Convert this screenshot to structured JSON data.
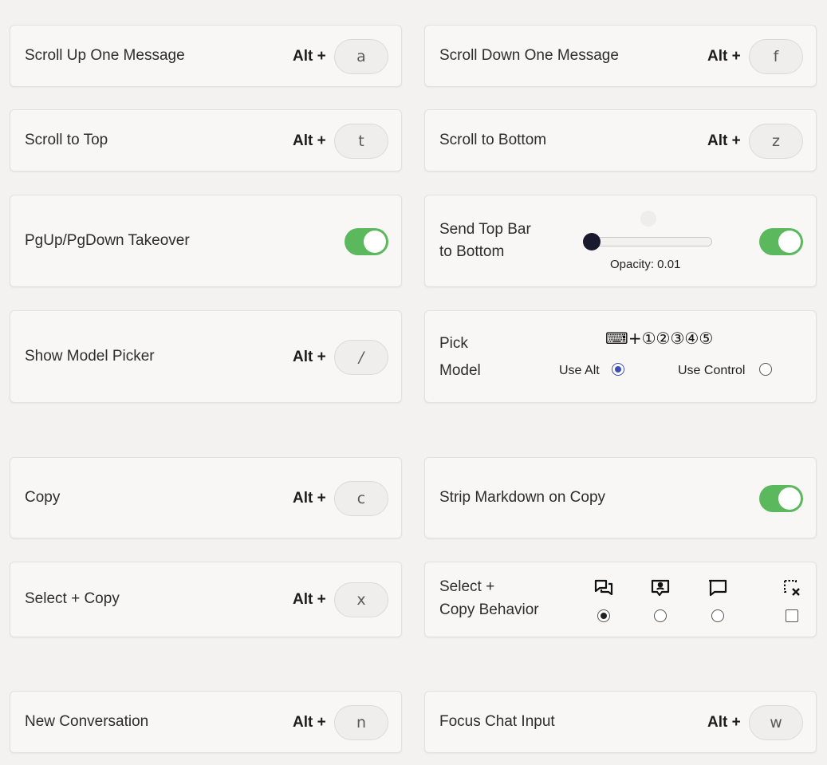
{
  "modifier_alt": "Alt +",
  "rows": {
    "scroll_up": {
      "label": "Scroll Up One Message",
      "key": "a"
    },
    "scroll_down": {
      "label": "Scroll Down One Message",
      "key": "f"
    },
    "scroll_top": {
      "label": "Scroll to Top",
      "key": "t"
    },
    "scroll_bottom": {
      "label": "Scroll to Bottom",
      "key": "z"
    },
    "pg_takeover": {
      "label": "PgUp/PgDown Takeover",
      "enabled": true
    },
    "send_top_bar": {
      "label_line1": "Send Top Bar",
      "label_line2": "to Bottom",
      "opacity_label": "Opacity: 0.01",
      "opacity_value": 0.01,
      "enabled": true
    },
    "model_picker": {
      "label": "Show Model Picker",
      "key": "/"
    },
    "pick_model": {
      "label_line1": "Pick",
      "label_line2": "Model",
      "hint": "⌨+①②③④⑤",
      "use_alt": "Use Alt",
      "use_control": "Use Control",
      "selected": "alt"
    },
    "copy": {
      "label": "Copy",
      "key": "c"
    },
    "strip_markdown": {
      "label": "Strip Markdown on Copy",
      "enabled": true
    },
    "select_copy": {
      "label": "Select + Copy",
      "key": "x"
    },
    "copy_behavior": {
      "label_line1": "Select +",
      "label_line2": "Copy Behavior",
      "selected_option": 0
    },
    "new_conversation": {
      "label": "New Conversation",
      "key": "n"
    },
    "focus_chat": {
      "label": "Focus Chat Input",
      "key": "w"
    }
  },
  "colors": {
    "toggle_on": "#5cb85c",
    "radio_selected": "#3b4fb8",
    "slider_thumb": "#1a1a2e"
  }
}
